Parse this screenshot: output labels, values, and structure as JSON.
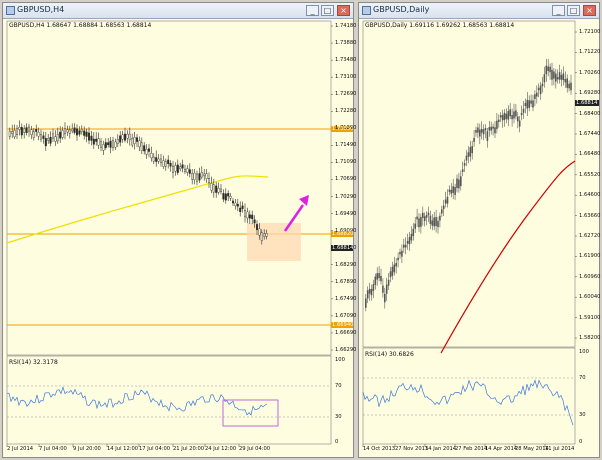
{
  "left_window": {
    "title": "GBPUSD,H4",
    "info": "GBPUSD,H4  1.68647 1.68884 1.68563 1.68814",
    "price_labels": [
      "1.74180",
      "1.73880",
      "1.73480",
      "1.73100",
      "1.72690",
      "1.72280",
      "1.71890",
      "1.71490",
      "1.71090",
      "1.70690",
      "1.70290",
      "1.69490",
      "1.69090",
      "1.68690",
      "1.68290",
      "1.67890",
      "1.67490",
      "1.67090",
      "1.66690",
      "1.66290"
    ],
    "marker_top": "1.71850",
    "marker_mid": "1.68820",
    "current_price": "1.68814",
    "marker_bottom": "1.66940",
    "rsi_label": "RSI(14) 32.3178",
    "rsi_levels": [
      "100",
      "70",
      "30",
      "0"
    ],
    "dates": [
      "2 Jul 2014",
      "7 Jul 04:00",
      "9 Jul 20:00",
      "14 Jul 12:00",
      "17 Jul 04:00",
      "21 Jul 20:00",
      "24 Jul 12:00",
      "29 Jul 04:00"
    ]
  },
  "right_window": {
    "title": "GBPUSD,Daily",
    "info": "GBPUSD,Daily  1.69116 1.69262 1.68563 1.68814",
    "price_labels": [
      "1.72100",
      "1.71220",
      "1.70260",
      "1.69280",
      "1.68400",
      "1.67440",
      "1.66480",
      "1.65520",
      "1.64600",
      "1.63660",
      "1.62720",
      "1.61900",
      "1.60960",
      "1.60040",
      "1.59100",
      "1.58200"
    ],
    "current_price": "1.68814",
    "rsi_label": "RSI(14) 30.6826",
    "rsi_levels": [
      "100",
      "70",
      "30",
      "0"
    ],
    "dates": [
      "14 Oct 2013",
      "27 Nov 2013",
      "14 Jan 2014",
      "27 Feb 2014",
      "14 Apr 2014",
      "28 May 2014",
      "11 Jul 2014"
    ]
  },
  "colors": {
    "bg": "#fffde0",
    "candle": "#2a2a2a",
    "ma_yellow": "#f0e000",
    "ma_red": "#cc0000",
    "hline": "#f0a000",
    "rsi": "#3a7ad8",
    "arrow": "#e020e0",
    "box": "#ffd7b0"
  }
}
